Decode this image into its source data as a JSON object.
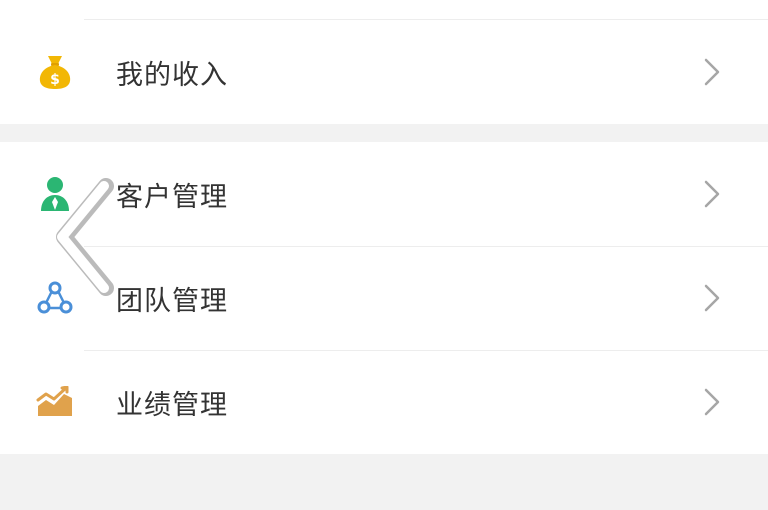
{
  "menu": {
    "section1": [
      {
        "label": "我的收入",
        "icon": "money-bag-icon"
      }
    ],
    "section2": [
      {
        "label": "客户管理",
        "icon": "customer-icon"
      },
      {
        "label": "团队管理",
        "icon": "team-icon"
      },
      {
        "label": "业绩管理",
        "icon": "performance-chart-icon"
      }
    ]
  },
  "colors": {
    "page_background": "#f2f2f2",
    "row_background": "#ffffff",
    "label_text": "#333333",
    "chevron": "#a6a6a6",
    "money_icon": "#f2b705",
    "customer_icon": "#2bb673",
    "team_icon": "#4a8fd8",
    "performance_icon": "#e0a24c"
  },
  "overlays": {
    "back_gesture_icon": "back-chevron-icon"
  }
}
